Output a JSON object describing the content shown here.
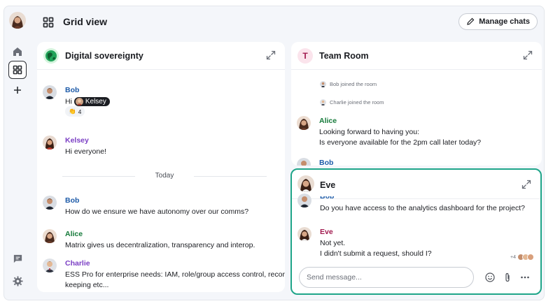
{
  "header": {
    "title": "Grid view",
    "manage_label": "Manage chats"
  },
  "rail": {
    "items": [
      "home-icon",
      "grid-icon",
      "plus-icon",
      "chat-icon",
      "settings-icon"
    ]
  },
  "rooms": {
    "digital": {
      "title": "Digital sovereignty",
      "messages": [
        {
          "name": "Bob",
          "lines": [
            "Hi"
          ],
          "mention": "Kelsey",
          "reaction": {
            "emoji": "👏",
            "count": "4"
          }
        },
        {
          "name": "Kelsey",
          "lines": [
            "Hi everyone!"
          ]
        },
        {
          "name": "Bob",
          "lines": [
            "How do we ensure we have autonomy over our comms?"
          ]
        },
        {
          "name": "Alice",
          "lines": [
            "Matrix gives us decentralization, transparency and interop."
          ]
        },
        {
          "name": "Charlie",
          "lines": [
            "ESS Pro for enterprise needs: IAM, role/group access control, record",
            "keeping etc..."
          ]
        }
      ],
      "divider": "Today"
    },
    "team": {
      "avatar_letter": "T",
      "title": "Team Room",
      "events": [
        "Bob joined the room",
        "Charlie joined the room"
      ],
      "messages": [
        {
          "name": "Alice",
          "lines": [
            "Looking forward to having you:",
            "Is everyone available for the 2pm call later today?"
          ]
        },
        {
          "name": "Bob",
          "lines": []
        }
      ]
    },
    "eve": {
      "title": "Eve",
      "partial_name": "Bob",
      "messages": [
        {
          "lines": [
            "Do you have access to the analytics dashboard for the project?"
          ]
        },
        {
          "name": "Eve",
          "lines": [
            "Not yet.",
            "I didn't submit a request, should I?"
          ]
        }
      ],
      "read_more": "+4",
      "placeholder": "Send message..."
    }
  },
  "colors": {
    "accent": "#1fa589",
    "bob": "#1c5aa8",
    "kelsey": "#7b3fc4",
    "alice": "#157a3a",
    "charlie": "#7b3fc4",
    "eve": "#a11a4f"
  }
}
